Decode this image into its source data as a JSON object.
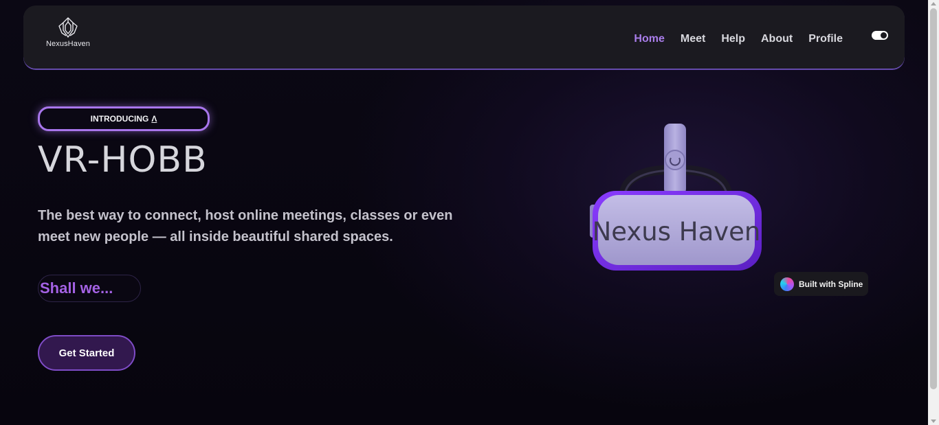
{
  "brand": {
    "name": "NexusHaven"
  },
  "nav": {
    "items": [
      {
        "label": "Home",
        "active": true
      },
      {
        "label": "Meet",
        "active": false
      },
      {
        "label": "Help",
        "active": false
      },
      {
        "label": "About",
        "active": false
      },
      {
        "label": "Profile",
        "active": false
      }
    ],
    "theme_toggle": "on"
  },
  "hero": {
    "badge_label": "INTRODUCING",
    "badge_symbol": "Λ",
    "title": "VR-HOBB",
    "subtitle": "The best way to connect, host online meetings, classes or even meet new people — all inside beautiful shared spaces.",
    "typing_text": "Shall we...",
    "cta_label": "Get Started"
  },
  "scene": {
    "headset_label": "Nexus Haven",
    "spline_badge": "Built with Spline"
  },
  "colors": {
    "accent": "#a97dea",
    "cta_bg": "#32184e",
    "headset_face": "#b1aad9",
    "headset_rim": "#7a2fe8"
  }
}
